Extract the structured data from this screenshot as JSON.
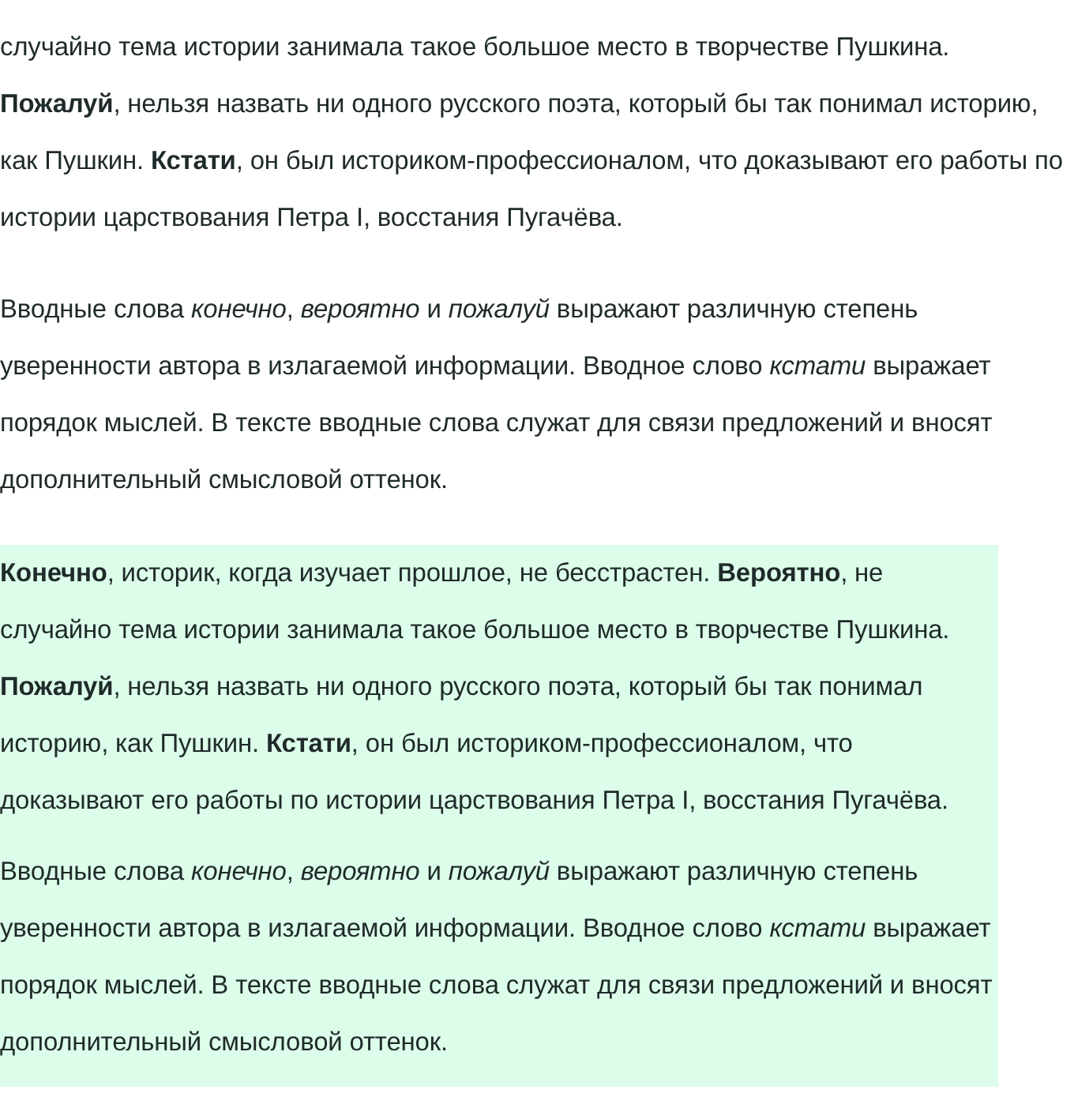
{
  "text_section": {
    "paragraphs": [
      "случайно тема истории занимала такое большое место в творчестве Пушкина. **Пожалуй**, нельзя назвать ни одного русского поэта, который бы так понимал историю, как Пушкин. **Кстати**, он был историком-профессионалом, что доказывают его работы по истории царствования Петра I, восстания Пугачёва.",
      "Вводные слова *конечно*, *вероятно* и *пожалуй* выражают различную степень уверенности автора в излагаемой информации. Вводное слово *кстати* выражает порядок мыслей. В тексте вводные слова служат для связи предложений и вносят дополнительный смысловой оттенок."
    ]
  },
  "highlighted_section": {
    "paragraphs": [
      "**Конечно**, историк, когда изучает прошлое, не бесстрастен. **Вероятно**, не случайно тема истории занимала такое большое место в творчестве Пушкина. **Пожалуй**, нельзя назвать ни одного русского поэта, который бы так понимал историю, как Пушкин. **Кстати**, он был историком-профессионалом, что доказывают его работы по истории царствования Петра I, восстания Пугачёва.",
      "Вводные слова *конечно*, *вероятно* и *пожалуй* выражают различную степень уверенности автора в излагаемой информации. Вводное слово *кстати* выражает порядок мыслей. В тексте вводные слова служат для связи предложений и вносят дополнительный смысловой оттенок."
    ]
  }
}
